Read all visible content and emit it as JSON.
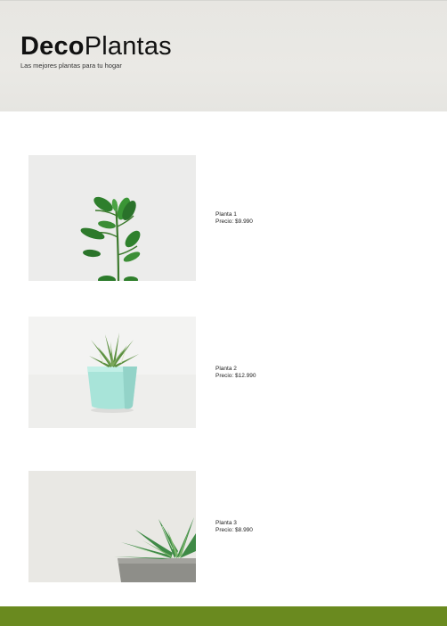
{
  "header": {
    "brand_bold": "Deco",
    "brand_light": "Plantas",
    "tagline": "Las mejores plantas para tu hogar"
  },
  "products": [
    {
      "name": "Planta 1",
      "price": "Precio: $9.990",
      "image_icon": "ficus-plant-photo"
    },
    {
      "name": "Planta 2",
      "price": "Precio: $12.990",
      "image_icon": "succulent-in-teal-pot-photo"
    },
    {
      "name": "Planta 3",
      "price": "Precio: $8.990",
      "image_icon": "succulent-in-gray-pot-photo"
    }
  ],
  "colors": {
    "header_bg": "#e8e7e3",
    "footer_bg": "#6a8a1f",
    "leaf_green": "#2f7d2e",
    "pot_teal": "#a6e3d8",
    "pot_gray": "#8b8b86"
  }
}
